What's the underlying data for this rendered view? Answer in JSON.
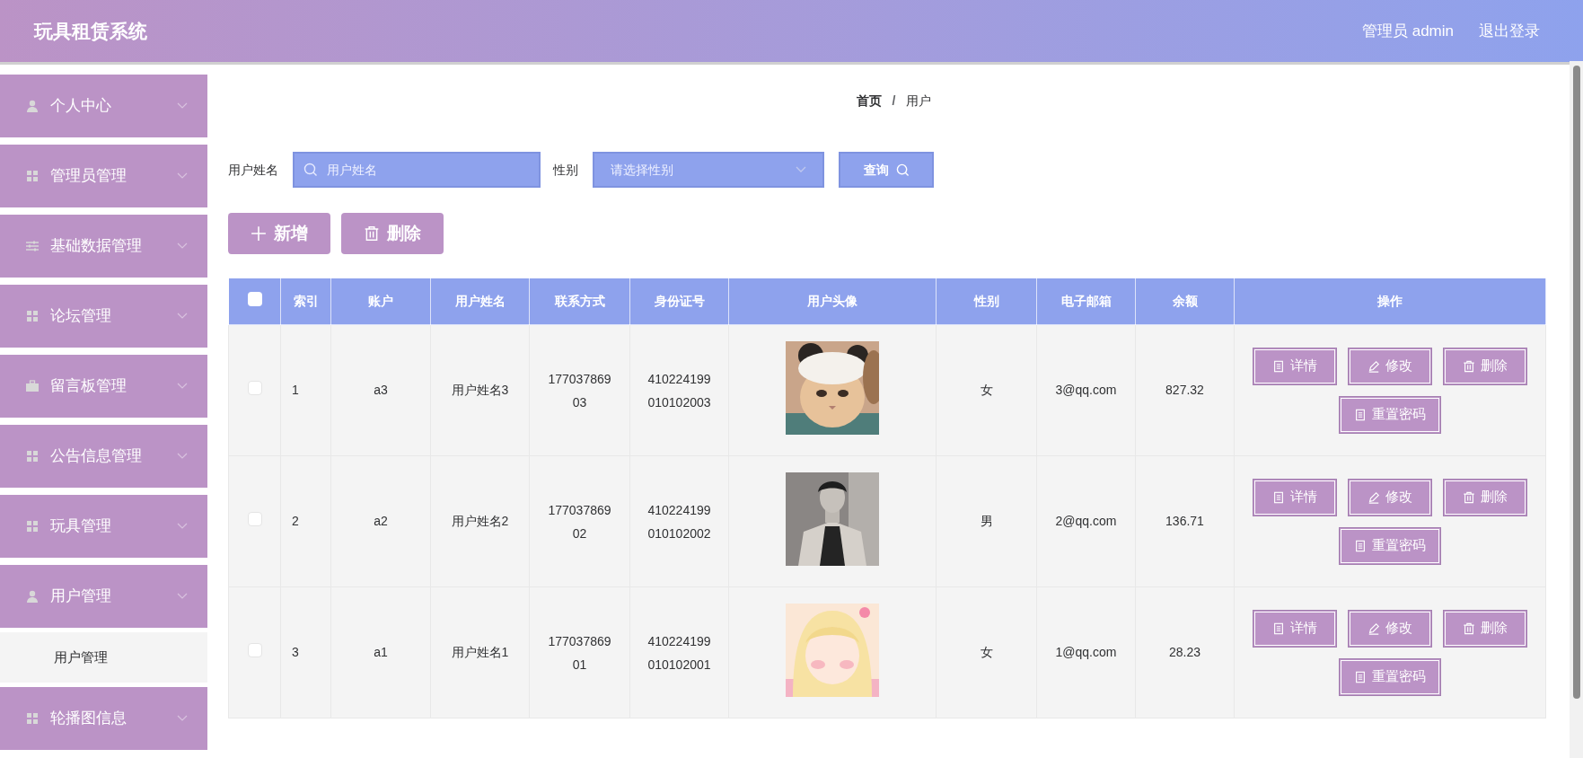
{
  "header": {
    "title": "玩具租赁系统",
    "user": "管理员 admin",
    "logout": "退出登录"
  },
  "sidebar": {
    "items": [
      {
        "label": "个人中心",
        "kind": "person"
      },
      {
        "label": "管理员管理",
        "kind": "grid"
      },
      {
        "label": "基础数据管理",
        "kind": "sliders"
      },
      {
        "label": "论坛管理",
        "kind": "grid"
      },
      {
        "label": "留言板管理",
        "kind": "briefcase"
      },
      {
        "label": "公告信息管理",
        "kind": "grid"
      },
      {
        "label": "玩具管理",
        "kind": "grid"
      },
      {
        "label": "用户管理",
        "kind": "person",
        "children": [
          {
            "label": "用户管理"
          }
        ]
      },
      {
        "label": "轮播图信息",
        "kind": "grid"
      }
    ]
  },
  "breadcrumb": {
    "home": "首页",
    "separator": "/",
    "current": "用户"
  },
  "search": {
    "name_label": "用户姓名",
    "name_placeholder": "用户姓名",
    "gender_label": "性别",
    "gender_placeholder": "请选择性别",
    "query_button": "查询"
  },
  "actions": {
    "add": "新增",
    "delete": "删除"
  },
  "table": {
    "header_checked": false,
    "columns": [
      "索引",
      "账户",
      "用户姓名",
      "联系方式",
      "身份证号",
      "用户头像",
      "性别",
      "电子邮箱",
      "余额",
      "操作"
    ],
    "rows": [
      {
        "checked": false,
        "index": "1",
        "account": "a3",
        "name": "用户姓名3",
        "phone": [
          "177037869",
          "03"
        ],
        "id_number": [
          "410224199",
          "010102003"
        ],
        "gender": "女",
        "email": "3@qq.com",
        "balance": "827.32",
        "buttons": [
          {
            "label": "详情",
            "kind": "detail"
          },
          {
            "label": "修改",
            "kind": "edit"
          },
          {
            "label": "删除",
            "kind": "delete"
          },
          {
            "label": "重置密码",
            "kind": "reset"
          }
        ]
      },
      {
        "checked": false,
        "index": "2",
        "account": "a2",
        "name": "用户姓名2",
        "phone": [
          "177037869",
          "02"
        ],
        "id_number": [
          "410224199",
          "010102002"
        ],
        "gender": "男",
        "email": "2@qq.com",
        "balance": "136.71",
        "buttons": [
          {
            "label": "详情",
            "kind": "detail"
          },
          {
            "label": "修改",
            "kind": "edit"
          },
          {
            "label": "删除",
            "kind": "delete"
          },
          {
            "label": "重置密码",
            "kind": "reset"
          }
        ]
      },
      {
        "checked": false,
        "index": "3",
        "account": "a1",
        "name": "用户姓名1",
        "phone": [
          "177037869",
          "01"
        ],
        "id_number": [
          "410224199",
          "010102001"
        ],
        "gender": "女",
        "email": "1@qq.com",
        "balance": "28.23",
        "buttons": [
          {
            "label": "详情",
            "kind": "detail"
          },
          {
            "label": "修改",
            "kind": "edit"
          },
          {
            "label": "删除",
            "kind": "delete"
          },
          {
            "label": "重置密码",
            "kind": "reset"
          }
        ]
      }
    ]
  }
}
